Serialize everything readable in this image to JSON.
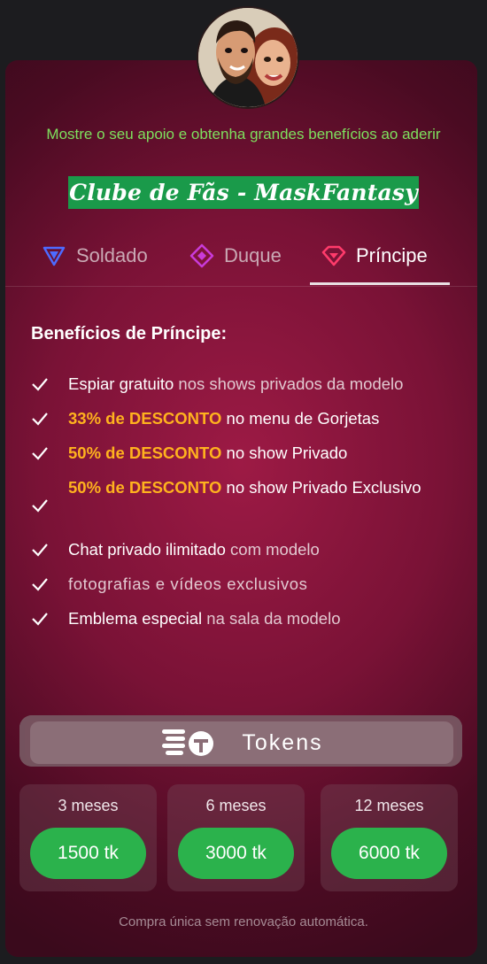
{
  "header": {
    "support_text": "Mostre o seu apoio e obtenha grandes benefícios ao aderir",
    "club_title": "Clube de Fãs - MaskFantasy"
  },
  "tabs": [
    {
      "label": "Soldado",
      "icon": "triangle-badge-icon",
      "active": false
    },
    {
      "label": "Duque",
      "icon": "diamond-badge-icon",
      "active": false
    },
    {
      "label": "Príncipe",
      "icon": "gem-badge-icon",
      "active": true
    }
  ],
  "benefits": {
    "title": "Benefícios de Príncipe:",
    "items": [
      {
        "strong": "Espiar gratuito",
        "rest": " nos shows privados da modelo"
      },
      {
        "highlight": "33% de DESCONTO",
        "rest": " no menu de Gorjetas"
      },
      {
        "highlight": "50% de DESCONTO",
        "rest": " no show Privado"
      },
      {
        "highlight": "50% de DESCONTO",
        "rest": " no show Privado Exclusivo"
      },
      {
        "strong": "Chat privado ilimitado",
        "rest": " com modelo"
      },
      {
        "strong": "fotografias e vídeos exclusivos",
        "rest": ""
      },
      {
        "strong": "Emblema especial",
        "rest": " na sala da modelo"
      }
    ]
  },
  "tokens": {
    "label": "Tokens",
    "icon": "coins-stack-icon"
  },
  "plans": [
    {
      "duration": "3 meses",
      "price": "1500 tk"
    },
    {
      "duration": "6 meses",
      "price": "3000 tk"
    },
    {
      "duration": "12 meses",
      "price": "6000 tk"
    }
  ],
  "footer": {
    "note": "Compra única sem renovação automática."
  },
  "colors": {
    "card_bg": "#7a1236",
    "highlight": "#ffb21e",
    "support_text": "#7ee05e",
    "club_bg": "#1a9a4a",
    "button_green": "#2bb24c"
  }
}
